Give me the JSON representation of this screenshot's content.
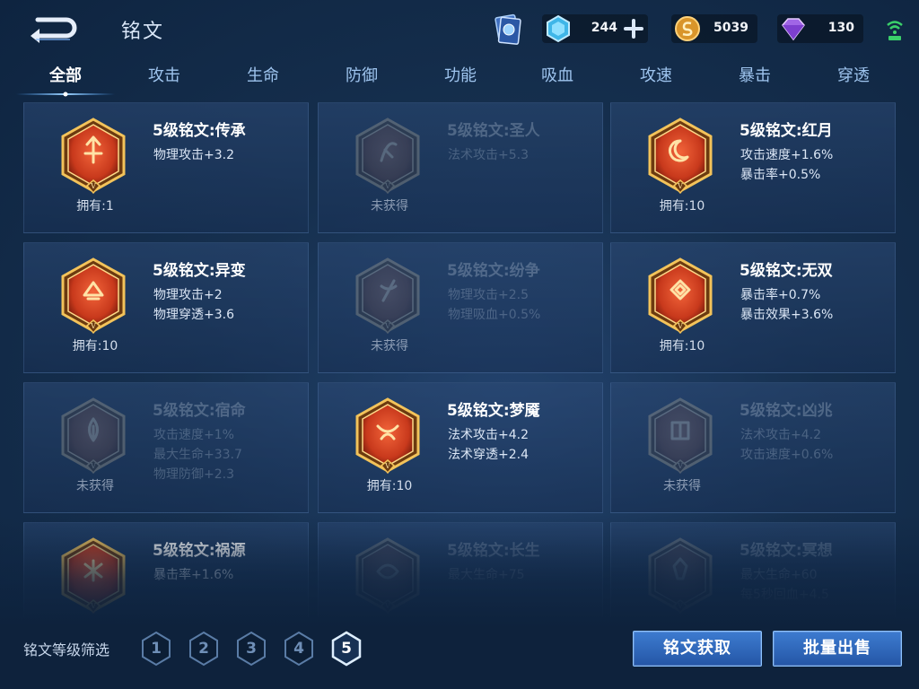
{
  "header": {
    "title": "铭文",
    "currencies": {
      "crystal": "244",
      "gold": "5039",
      "gem": "130"
    }
  },
  "tabs": [
    {
      "label": "全部",
      "active": true
    },
    {
      "label": "攻击",
      "active": false
    },
    {
      "label": "生命",
      "active": false
    },
    {
      "label": "防御",
      "active": false
    },
    {
      "label": "功能",
      "active": false
    },
    {
      "label": "吸血",
      "active": false
    },
    {
      "label": "攻速",
      "active": false
    },
    {
      "label": "暴击",
      "active": false
    },
    {
      "label": "穿透",
      "active": false
    }
  ],
  "runes": [
    {
      "name": "5级铭文:传承",
      "attrs": [
        "物理攻击+3.2"
      ],
      "owned": "拥有:1",
      "obtained": true,
      "color": "#c8391c"
    },
    {
      "name": "5级铭文:圣人",
      "attrs": [
        "法术攻击+5.3"
      ],
      "owned": "未获得",
      "obtained": false,
      "color": "#c8391c"
    },
    {
      "name": "5级铭文:红月",
      "attrs": [
        "攻击速度+1.6%",
        "暴击率+0.5%"
      ],
      "owned": "拥有:10",
      "obtained": true,
      "color": "#c8391c"
    },
    {
      "name": "5级铭文:异变",
      "attrs": [
        "物理攻击+2",
        "物理穿透+3.6"
      ],
      "owned": "拥有:10",
      "obtained": true,
      "color": "#c8391c"
    },
    {
      "name": "5级铭文:纷争",
      "attrs": [
        "物理攻击+2.5",
        "物理吸血+0.5%"
      ],
      "owned": "未获得",
      "obtained": false,
      "color": "#c8391c"
    },
    {
      "name": "5级铭文:无双",
      "attrs": [
        "暴击率+0.7%",
        "暴击效果+3.6%"
      ],
      "owned": "拥有:10",
      "obtained": true,
      "color": "#c8391c"
    },
    {
      "name": "5级铭文:宿命",
      "attrs": [
        "攻击速度+1%",
        "最大生命+33.7",
        "物理防御+2.3"
      ],
      "owned": "未获得",
      "obtained": false,
      "color": "#c8391c"
    },
    {
      "name": "5级铭文:梦魇",
      "attrs": [
        "法术攻击+4.2",
        "法术穿透+2.4"
      ],
      "owned": "拥有:10",
      "obtained": true,
      "color": "#c8391c"
    },
    {
      "name": "5级铭文:凶兆",
      "attrs": [
        "法术攻击+4.2",
        "攻击速度+0.6%"
      ],
      "owned": "未获得",
      "obtained": false,
      "color": "#c8391c"
    },
    {
      "name": "5级铭文:祸源",
      "attrs": [
        "暴击率+1.6%"
      ],
      "owned": "",
      "obtained": true,
      "color": "#c8391c"
    },
    {
      "name": "5级铭文:长生",
      "attrs": [
        "最大生命+75"
      ],
      "owned": "",
      "obtained": false,
      "color": "#c8391c"
    },
    {
      "name": "5级铭文:冥想",
      "attrs": [
        "最大生命+60",
        "每5秒回血+4.5"
      ],
      "owned": "",
      "obtained": false,
      "color": "#c8391c"
    }
  ],
  "footer": {
    "filter_label": "铭文等级筛选",
    "levels": [
      "1",
      "2",
      "3",
      "4",
      "5"
    ],
    "active_level": "5",
    "obtain_button": "铭文获取",
    "sell_button": "批量出售"
  },
  "colors": {
    "accent_blue": "#2f6cc4",
    "gold": "#e6a93a",
    "rune_red": "#c8391c"
  },
  "icons": [
    "back-arrow-icon",
    "rune-book-icon",
    "crystal-icon",
    "plus-icon",
    "gold-coin-icon",
    "gem-icon",
    "wifi-icon"
  ]
}
